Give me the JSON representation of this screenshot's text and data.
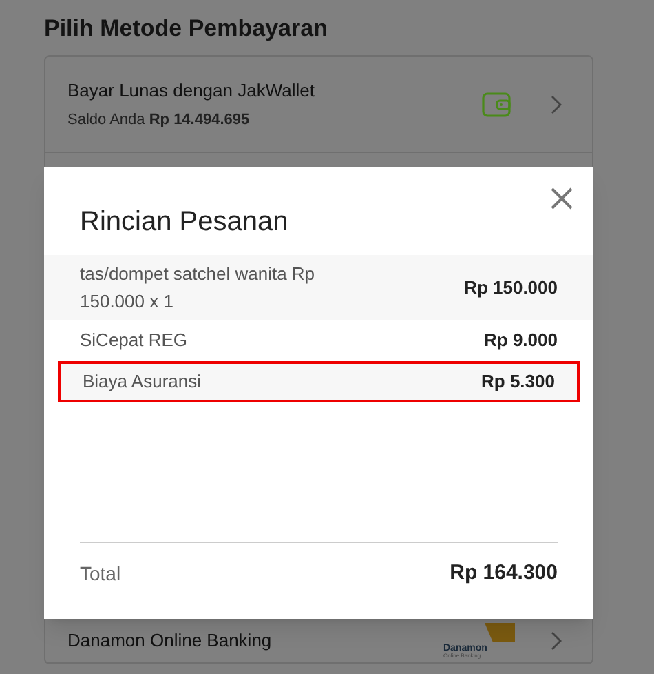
{
  "page": {
    "title": "Pilih Metode Pembayaran"
  },
  "payment_methods": [
    {
      "kind": "wallet",
      "label": "Bayar Lunas dengan JakWallet",
      "balance_label": "Saldo Anda",
      "balance": "Rp 14.494.695"
    },
    {
      "kind": "bank",
      "label": "Danamon Online Banking",
      "logo_name": "Danamon",
      "logo_sub": "Online Banking"
    }
  ],
  "modal": {
    "title": "Rincian Pesanan",
    "items": [
      {
        "label": "tas/dompet satchel wanita Rp 150.000 x 1",
        "amount": "Rp 150.000",
        "highlighted": false
      },
      {
        "label": "SiCepat REG",
        "amount": "Rp 9.000",
        "highlighted": false
      },
      {
        "label": "Biaya Asuransi",
        "amount": "Rp 5.300",
        "highlighted": true
      }
    ],
    "total_label": "Total",
    "total": "Rp 164.300"
  }
}
